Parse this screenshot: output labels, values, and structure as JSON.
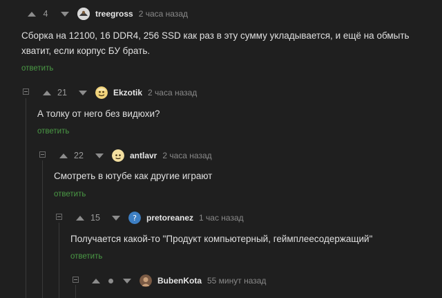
{
  "comments": [
    {
      "rating": "4",
      "username": "treegross",
      "time": "2 часа назад",
      "text_lines": [
        "Сборка на 12100, 16 DDR4, 256 SSD как раз в эту сумму укладывается, и ещё на обмыть",
        "хватит, если корпус БУ брать."
      ],
      "reply": "ответить"
    },
    {
      "rating": "21",
      "username": "Ekzotik",
      "time": "2 часа назад",
      "text": "А толку от него без видюхи?",
      "reply": "ответить"
    },
    {
      "rating": "22",
      "username": "antlavr",
      "time": "2 часа назад",
      "text": "Смотреть в ютубе как другие играют",
      "reply": "ответить"
    },
    {
      "rating": "15",
      "username": "pretoreanez",
      "time": "1 час назад",
      "text": "Получается какой-то \"Продукт компьютерный, геймплеесодержащий\"",
      "reply": "ответить"
    },
    {
      "username": "BubenKota",
      "time": "55 минут назад"
    }
  ],
  "colors": {
    "background": "#1f1f1f",
    "reply_link": "#4a9a45",
    "vote_arrow": "#8c8c8c"
  },
  "icons": {
    "upvote": "triangle-up-icon",
    "downvote": "triangle-down-icon",
    "collapse": "minus-box-icon"
  }
}
